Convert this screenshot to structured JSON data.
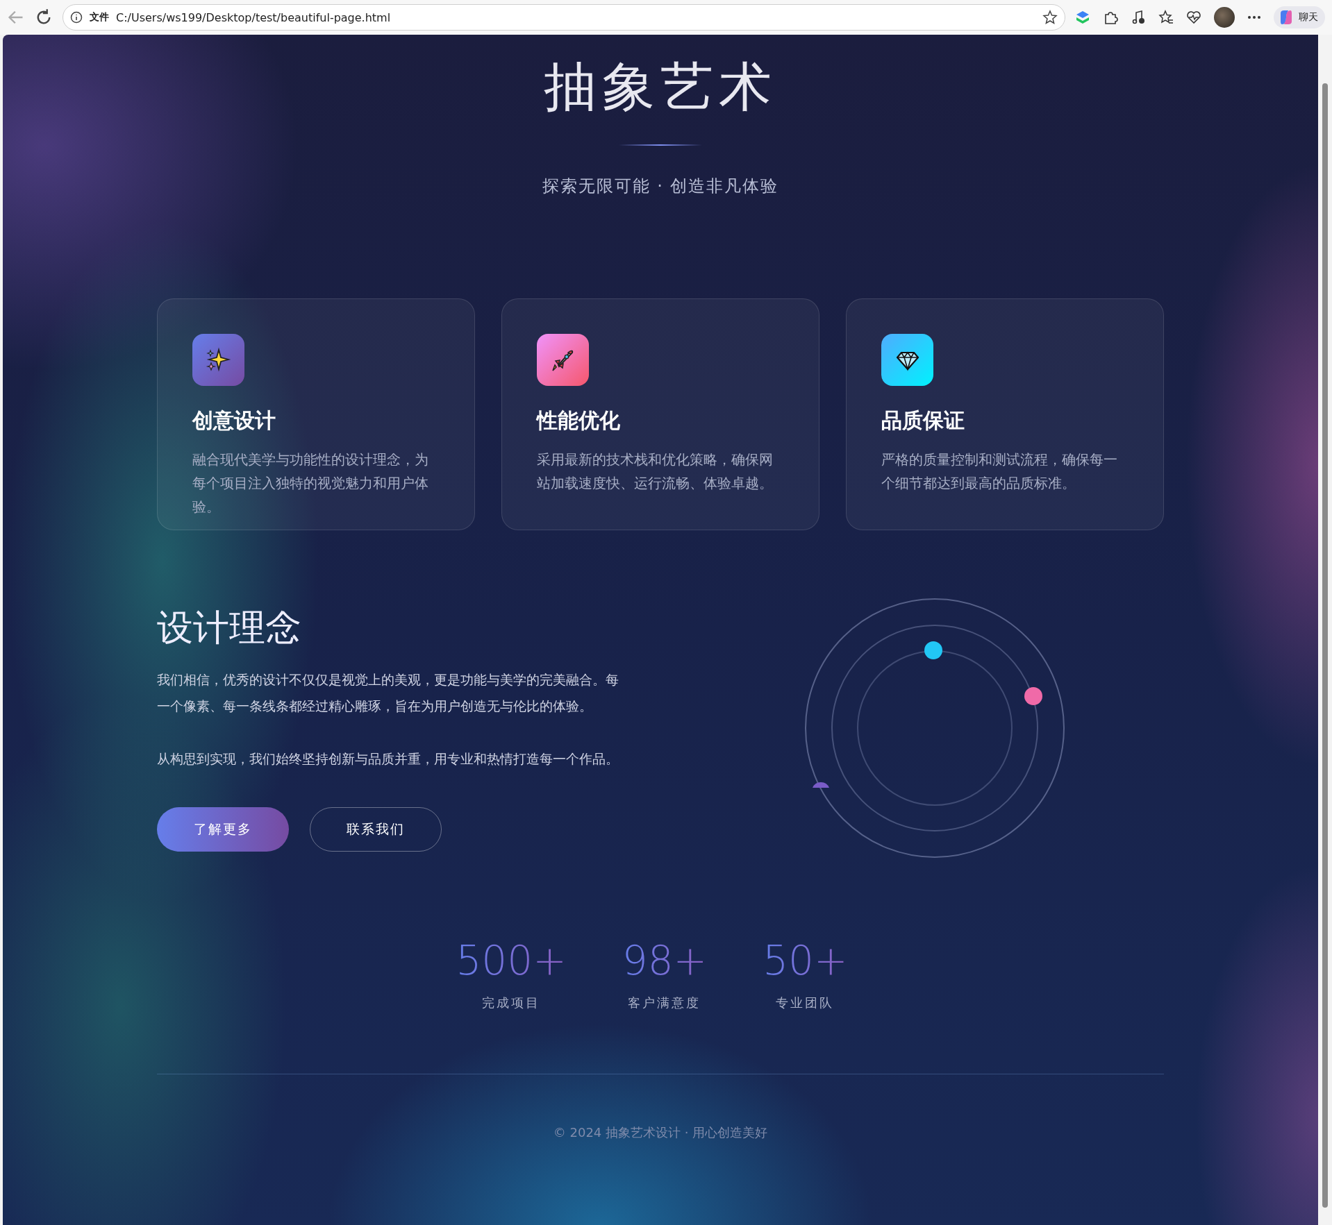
{
  "browser": {
    "file_label": "文件",
    "url": "C:/Users/ws199/Desktop/test/beautiful-page.html",
    "chat_label": "聊天"
  },
  "hero": {
    "title": "抽象艺术",
    "subtitle": "探索无限可能 · 创造非凡体验"
  },
  "features": [
    {
      "kind": "sparkle",
      "title": "创意设计",
      "description": "融合现代美学与功能性的设计理念，为每个项目注入独特的视觉魅力和用户体验。"
    },
    {
      "kind": "rocket",
      "title": "性能优化",
      "description": "采用最新的技术栈和优化策略，确保网站加载速度快、运行流畅、体验卓越。"
    },
    {
      "kind": "gem",
      "title": "品质保证",
      "description": "严格的质量控制和测试流程，确保每一个细节都达到最高的品质标准。"
    }
  ],
  "philosophy": {
    "title": "设计理念",
    "paragraphs": [
      "我们相信，优秀的设计不仅仅是视觉上的美观，更是功能与美学的完美融合。每一个像素、每一条线条都经过精心雕琢，旨在为用户创造无与伦比的体验。",
      "从构思到实现，我们始终坚持创新与品质并重，用专业和热情打造每一个作品。"
    ],
    "buttons": [
      {
        "kind": "primary",
        "label": "了解更多"
      },
      {
        "kind": "outline",
        "label": "联系我们"
      }
    ]
  },
  "stats": [
    {
      "value": "500+",
      "label": "完成项目"
    },
    {
      "value": "98+",
      "label": "客户满意度"
    },
    {
      "value": "50+",
      "label": "专业团队"
    }
  ],
  "footer": {
    "text": "© 2024 抽象艺术设计 · 用心创造美好"
  }
}
